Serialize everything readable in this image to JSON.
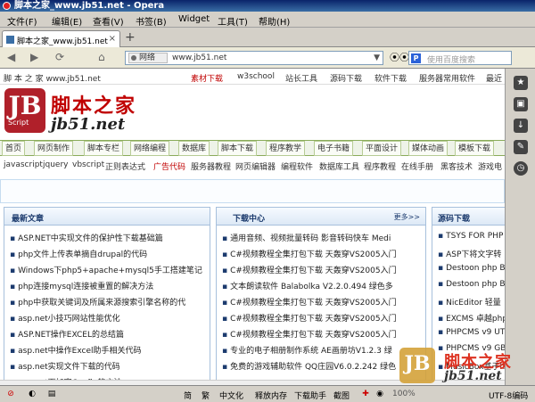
{
  "window": {
    "title": "脚本之家_www.jb51.net - Opera"
  },
  "menu": [
    "文件(F)",
    "编辑(E)",
    "查看(V)",
    "书签(B)",
    "Widget",
    "工具(T)",
    "帮助(H)"
  ],
  "tab": {
    "title": "脚本之家_www.jb51.net",
    "close": "×",
    "new_tab": "+"
  },
  "nav": {
    "back": "◀",
    "forward": "▶",
    "reload": "⟳",
    "home": "⌂",
    "site_badge": "网络",
    "url": "www.jb51.net",
    "search_icon_text": "P",
    "search_placeholder": "使用百度搜索"
  },
  "page": {
    "toplinks": [
      "脚 本 之 家 www.jb51.net",
      "素材下载",
      "w3school",
      "站长工具",
      "源码下载",
      "软件下载",
      "服务器常用软件",
      "最近"
    ],
    "logo": {
      "mark": "JB",
      "mark_sub": "Script",
      "name_cn": "脚本之家",
      "name_en": "jb51.net"
    },
    "main_nav": [
      "首页",
      "网页制作",
      "脚本专栏",
      "网络编程",
      "数据库",
      "脚本下载",
      "程序教学",
      "电子书籍",
      "平面设计",
      "媒体动画",
      "模板下载"
    ],
    "sub_nav": [
      "javascript",
      "jquery",
      "vbscript",
      "正则表达式",
      "广告代码",
      "服务器教程",
      "网页编辑器",
      "编程软件",
      "数据库工具",
      "程序教程",
      "在线手册",
      "黑客技术",
      "游戏电"
    ],
    "panels": {
      "latest": {
        "title": "最新文章",
        "items": [
          "ASP.NET中实现文件的保护性下载基础篇",
          "php文件上传表单摘自drupal的代码",
          "Windows下php5+apache+mysql5手工搭建笔记",
          "php连接mysql连接被重置的解决方法",
          "php中获取关键词及所属来源搜索引擎名称的代",
          "asp.net小技巧网站性能优化",
          "ASP.NET操作EXCEL的总结篇",
          "asp.net中操作Excel助手相关代码",
          "asp.net实现文件下载的代码",
          "asp.net下加密Config的方法"
        ]
      },
      "download": {
        "title": "下载中心",
        "more": "更多>>",
        "items": [
          "通用音频、视频批量转码 影音转码快车 Medi",
          "C#视频教程全集打包下载 天轰穿VS2005入门",
          "C#视频教程全集打包下载 天轰穿VS2005入门",
          "文本朗读软件 Balabolka V2.2.0.494 绿色多",
          "C#视频教程全集打包下载 天轰穿VS2005入门",
          "C#视频教程全集打包下载 天轰穿VS2005入门",
          "C#视频教程全集打包下载 天轰穿VS2005入门",
          "专业的电子相册制作系统 AE画册坊V1.2.3 绿",
          "免费的游戏辅助软件 QQ庄园V6.0.2.242 绿色"
        ]
      },
      "source": {
        "title": "源码下载",
        "items": [
          "TSYS FOR PHP",
          "ASP下将文字转",
          "Destoon php B2",
          "Destoon php B2",
          "NicEditor 轻量",
          "EXCMS 卓越php",
          "PHPCMS v9 UTF",
          "PHPCMS v9 GBK",
          "MusicBox基于ht"
        ]
      }
    },
    "watermark": {
      "mark": "JB",
      "name_cn": "脚本之家",
      "name_en": "jb51.net"
    }
  },
  "status": [
    "简",
    "繁",
    "中文化",
    "释放内存",
    "下载助手",
    "截图",
    "100%",
    "UTF-8编码"
  ],
  "colors": {
    "title_bar": "#0a246a",
    "brand_red": "#c00000",
    "panel_border": "#a7c0dc",
    "nav_green": "#8aab5a"
  }
}
